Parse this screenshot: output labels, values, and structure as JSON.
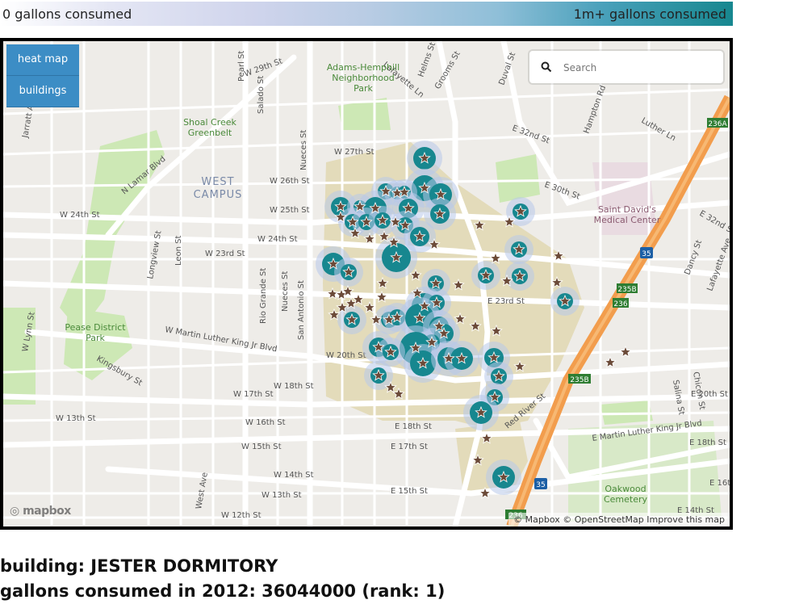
{
  "legend": {
    "low_label": "0 gallons consumed",
    "high_label": "1m+ gallons consumed"
  },
  "controls": {
    "heatmap_label": "heat map",
    "buildings_label": "buildings"
  },
  "search": {
    "placeholder": "Search"
  },
  "map_labels": {
    "adams": "Adams-Hemphill",
    "adams2": "Neighborhood",
    "adams3": "Park",
    "shoal": "Shoal Creek",
    "shoal2": "Greenbelt",
    "westcampus": "WEST",
    "westcampus2": "CAMPUS",
    "stdavid": "Saint David's",
    "stdavid2": "Medical Center",
    "pease": "Pease District",
    "pease2": "Park",
    "oakwood": "Oakwood",
    "oakwood2": "Cemetery",
    "w29": "W 29th St",
    "w27": "W 27th St",
    "w26": "W 26th St",
    "w25": "W 25th St",
    "w24a": "W 24th St",
    "w24b": "W 24th St",
    "w23": "W 23rd St",
    "w20": "W 20th St",
    "w18": "W 18th St",
    "w17": "W 17th St",
    "w16": "W 16th St",
    "w15": "W 15th St",
    "w14": "W 14th St",
    "w13a": "W 13th St",
    "w13b": "W 13th St",
    "w12": "W 12th St",
    "mlk": "W Martin Luther King Jr Blvd",
    "emlk": "E Martin Luther King Jr Blvd",
    "nlamar": "N Lamar Blvd",
    "guad": "Nueces St",
    "rio": "Rio Grande St",
    "nueces2": "Nueces St",
    "sanantonio": "San Antonio St",
    "e32": "E 32nd St",
    "e30": "E 30th St",
    "e23": "E 23rd St",
    "e18": "E 18th St",
    "e17": "E 17th St",
    "e15": "E 15th St",
    "e20": "E 20th St",
    "e18b": "E 18th St",
    "e16": "E 16th",
    "e14": "E 14th St",
    "redriver": "Red River St",
    "duval": "Duval St",
    "hampton": "Hampton Rd",
    "luther": "Luther Ln",
    "salina": "Salina St",
    "chicon": "Chicon St",
    "dancy": "Dancy St",
    "lafayette": "Lafayette Ave",
    "e32b": "E 32nd St",
    "salado": "Salado St",
    "pearl": "Pearl St",
    "leon": "Leon St",
    "longview": "Longview St",
    "westave": "West Ave",
    "kingsbury": "Kingsbury St",
    "wlynn": "W Lynn St",
    "jarratt": "Jarratt Av",
    "helms": "Helms St",
    "grooms": "Grooms St",
    "lafayette2": "Lafayette Ln",
    "h35": "35",
    "h35b": "35",
    "i235b": "235B",
    "i236": "236",
    "i236a": "236A",
    "i235b2": "235B",
    "i236b": "236"
  },
  "mapbox_logo": "mapbox",
  "attribution": "© Mapbox © OpenStreetMap  Improve this map",
  "info": {
    "building_line": "building: JESTER DORMITORY",
    "gallons_line": "gallons consumed in 2012: 36044000 (rank: 1)"
  },
  "colors": {
    "heat_high": "#17878f",
    "star": "#6b4a38",
    "campus": "#e3dbba",
    "freeway": "#f29d4d",
    "control": "#3c8dc5"
  }
}
